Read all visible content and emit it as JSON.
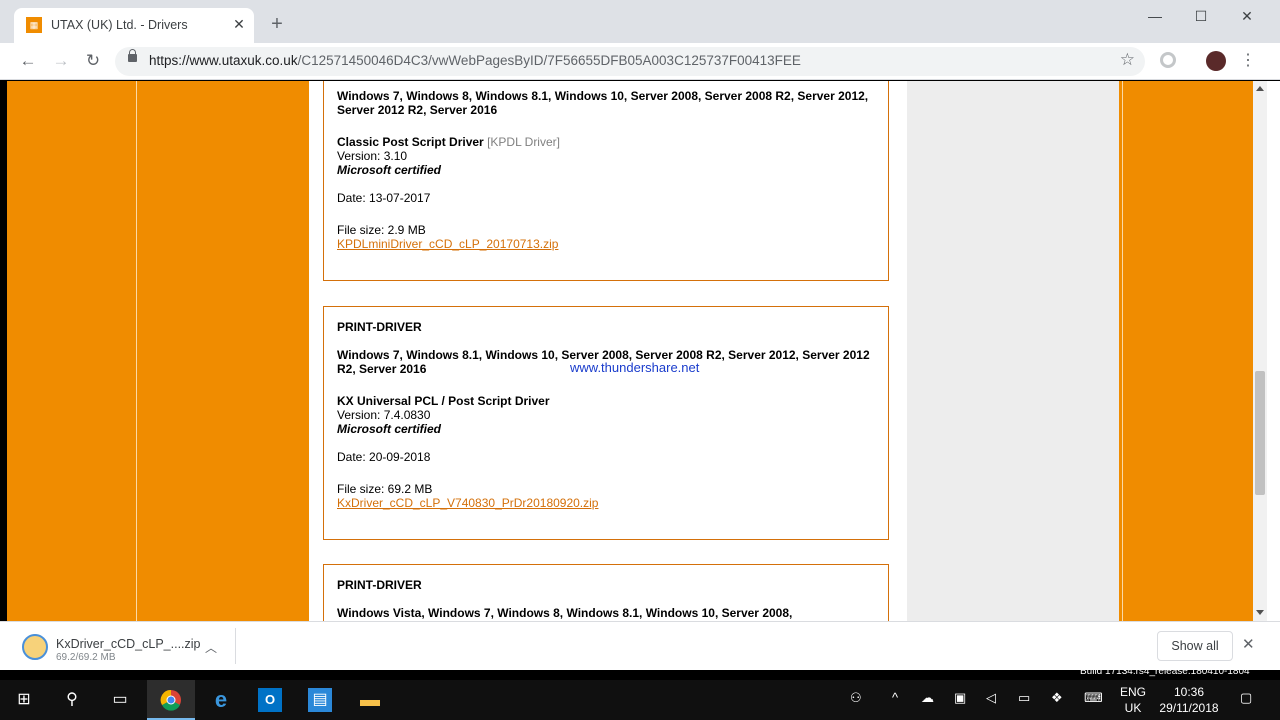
{
  "browser": {
    "tab_title": "UTAX (UK) Ltd. - Drivers",
    "tab_favicon": "UTAX",
    "new_tab": "+",
    "url_host": "https://www.utaxuk.co.uk",
    "url_path": "/C12571450046D4C3/vwWebPagesByID/7F56655DFB05A003C125737F00413FEE",
    "win_min": "—",
    "win_max": "☐",
    "win_close": "✕"
  },
  "content": {
    "box1": {
      "os_list": "Windows 7, Windows 8, Windows 8.1, Windows 10, Server 2008, Server 2008 R2, Server 2012,",
      "os_list2": "Server 2012 R2, Server 2016",
      "driver_name": "Classic Post Script Driver",
      "driver_tag": "[KPDL Driver]",
      "version": "Version: 3.10",
      "certified": "Microsoft certified",
      "date": "Date: 13-07-2017",
      "filesize": "File size: 2.9 MB",
      "file_link": "KPDLminiDriver_cCD_cLP_20170713.zip"
    },
    "box2": {
      "heading": "PRINT-DRIVER",
      "os_list": "Windows 7, Windows 8.1, Windows 10, Server 2008, Server 2008 R2, Server 2012, Server 2012",
      "os_list2": "R2, Server 2016",
      "driver_name": "KX Universal PCL / Post Script Driver",
      "version": "Version: 7.4.0830",
      "certified": "Microsoft certified",
      "date": "Date: 20-09-2018",
      "filesize": "File size: 69.2 MB",
      "file_link": "KxDriver_cCD_cLP_V740830_PrDr20180920.zip"
    },
    "box3": {
      "heading": "PRINT-DRIVER",
      "os_list": "Windows Vista, Windows 7, Windows 8, Windows 8.1, Windows 10, Server 2008,"
    },
    "watermark": "www.thundershare.net"
  },
  "download_bar": {
    "file_name": "KxDriver_cCD_cLP_....zip",
    "progress": "69.2/69.2 MB",
    "show_all": "Show all",
    "close": "✕"
  },
  "taskbar": {
    "build_text": "Build 17134.rs4_release.180410-1804",
    "lang_line1": "ENG",
    "lang_line2": "UK",
    "time": "10:36",
    "date": "29/11/2018"
  }
}
